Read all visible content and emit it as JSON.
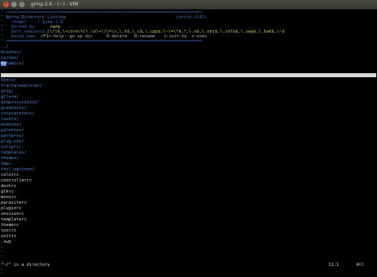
{
  "window": {
    "title": ".gimp-2.6 - (~) - VIM",
    "close_label": "×",
    "min_label": "–",
    "max_label": "□"
  },
  "header": {
    "border": "\" ============================================================================",
    "title_line": "\" Netrw Directory Listing",
    "version": "(netrw v142)",
    "path_label": "\"   /home/",
    "path_value": "/.gimp-2.6",
    "sorted_label": "\"   Sorted by",
    "sorted_value": "name",
    "sortseq_label": "\"   Sort sequence:",
    "sortseq_value": "[\\/]$,\\<core\\%(\\.\\d\\+\\)\\=\\>,\\.h$,\\.c$,\\.cpp$,\\~\\=\\*$,*,\\.o$,\\.obj$,\\.info$,\\.swp$,\\.bak$,\\~$",
    "quickmap_label": "\"   Quick map:",
    "quickmap_items": [
      "<F1>:help",
      "-:go up dir",
      "D:delete",
      "R:rename",
      "s:sort-by",
      "x:exec"
    ],
    "border2": "\" ============================================================================"
  },
  "entries": {
    "top": [
      "../",
      "brushes/",
      "curves/"
    ],
    "cursor_prefix": "dy",
    "cursor_suffix": "namics/",
    "dirs": [
      "fonts/",
      "fractalexplorer/",
      "gfig/",
      "gflare/",
      "gimpressionist/",
      "gradients/",
      "interpreters/",
      "levels/",
      "modules/",
      "palettes/",
      "patterns/",
      "plug-ins/",
      "scripts/",
      "templates/",
      "themes/",
      "tmp/",
      "tool-options/"
    ],
    "files": [
      "colorrc",
      "controllerrc",
      "dockrc",
      "gtkrc",
      "menurc",
      "parasiterc",
      "pluginrc",
      "sessionrc",
      "templaterc",
      "themerc",
      "toolrc",
      "unitrc",
      ".swp"
    ]
  },
  "tildes": [
    "~",
    "~",
    "~",
    "~",
    "~",
    "~",
    "~",
    "~",
    "~"
  ],
  "statusline": {
    "message": "\"~/\" is a directory",
    "position": "11,1",
    "scroll": "All"
  }
}
